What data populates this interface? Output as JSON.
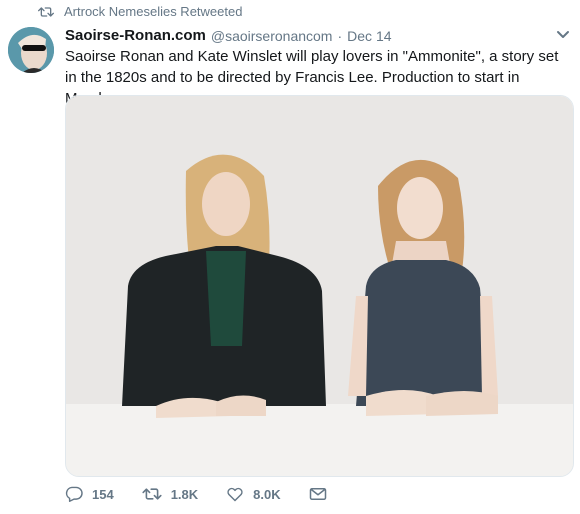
{
  "retweet": {
    "label": "Artrock Nemeselies Retweeted"
  },
  "tweet": {
    "author_name": "Saoirse-Ronan.com",
    "handle": "@saoirseronancom",
    "separator": "·",
    "date": "Dec 14",
    "text": "Saoirse Ronan and Kate Winslet will play lovers in \"Ammonite\", a story set in the 1820s and to be directed by Francis Lee. Production to start in March."
  },
  "actions": {
    "replies": "154",
    "retweets": "1.8K",
    "likes": "8.0K"
  },
  "colors": {
    "text": "#14171a",
    "muted": "#657786",
    "photo_background": "#e9e7e5"
  },
  "icons": [
    "retweet-icon",
    "chevron-down-icon",
    "reply-icon",
    "retweet-icon",
    "like-icon",
    "direct-message-icon"
  ]
}
